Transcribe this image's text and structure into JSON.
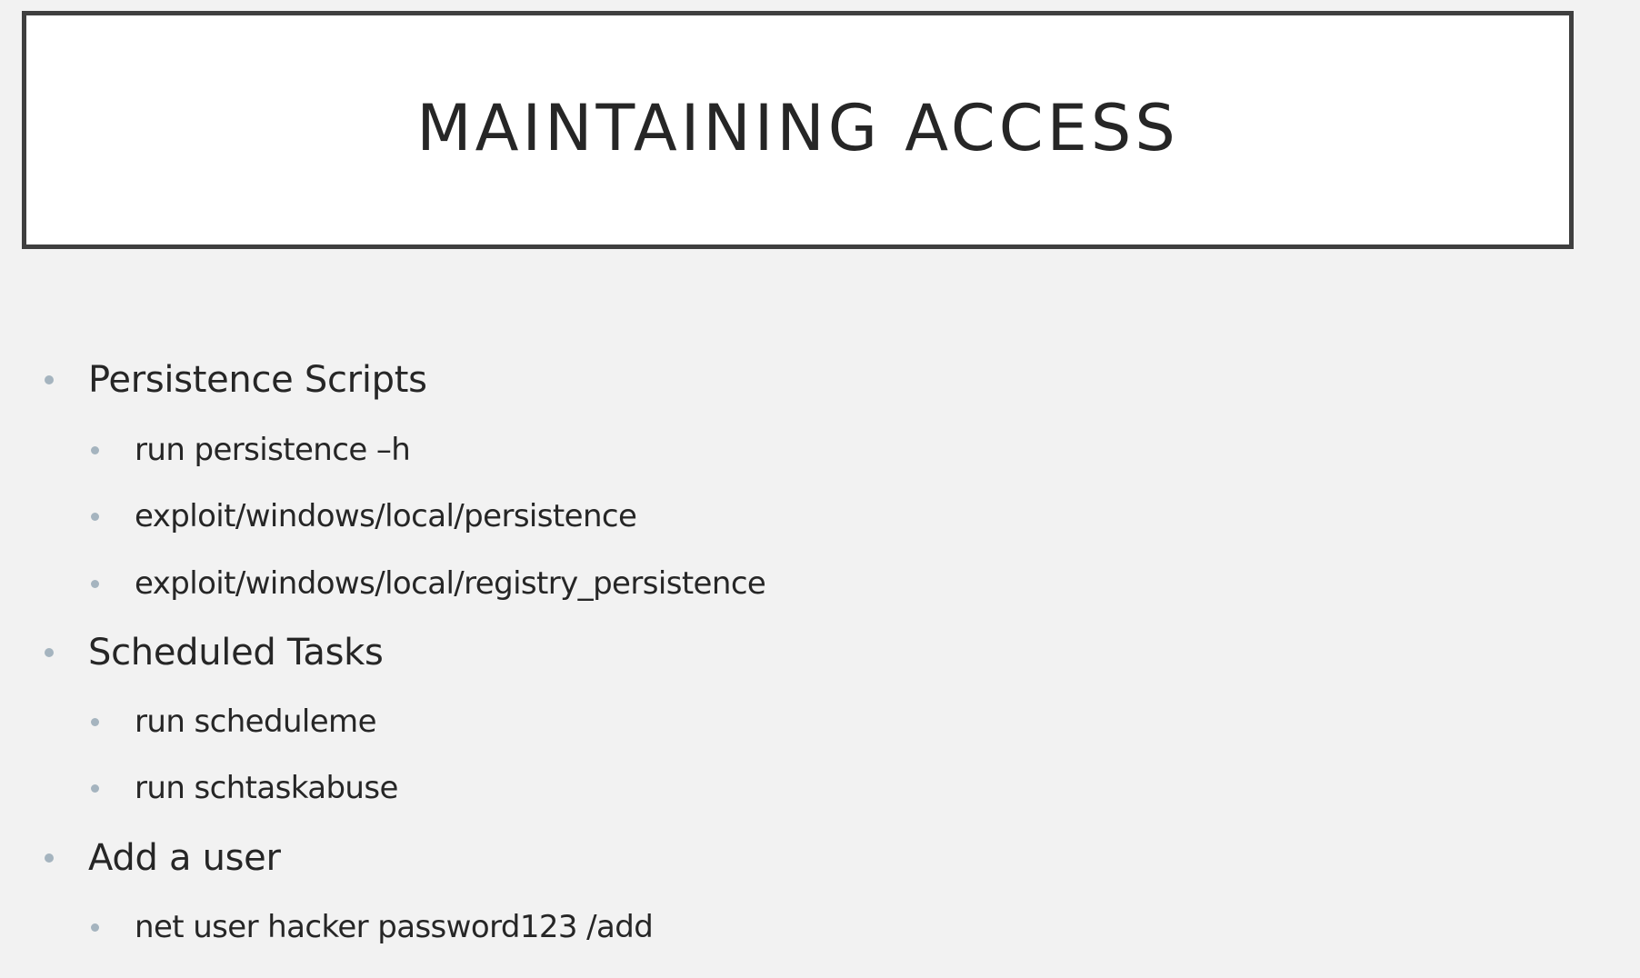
{
  "slide": {
    "title": "MAINTAINING ACCESS",
    "bullets": [
      {
        "label": "Persistence Scripts",
        "subitems": [
          "run persistence –h",
          "exploit/windows/local/persistence",
          "exploit/windows/local/registry_persistence"
        ]
      },
      {
        "label": "Scheduled Tasks",
        "subitems": [
          "run scheduleme",
          "run schtaskabuse"
        ]
      },
      {
        "label": "Add a user",
        "subitems": [
          "net user hacker password123 /add"
        ]
      }
    ]
  },
  "colors": {
    "background": "#f2f2f2",
    "title_box_fill": "#ffffff",
    "title_border": "#3f3f3f",
    "text": "#262626",
    "bullet": "#a5b4bf"
  }
}
